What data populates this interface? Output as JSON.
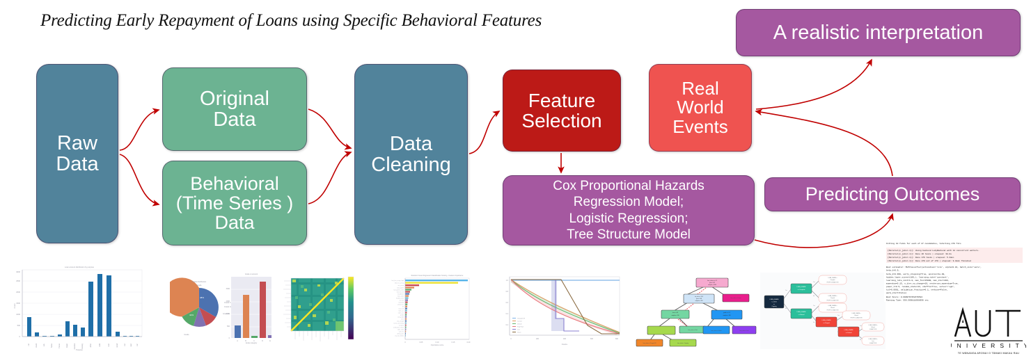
{
  "title": "Predicting Early Repayment of Loans using Specific Behavioral Features",
  "colors": {
    "steel_blue": "#51839b",
    "green": "#6cb392",
    "dark_red": "#bc1a17",
    "purple": "#a558a0",
    "salmon_red": "#ef5350",
    "arrow_red": "#c00000"
  },
  "flow": {
    "raw_data": "Raw\nData",
    "original_data": "Original\nData",
    "behavioral_data": "Behavioral\n(Time Series )\nData",
    "data_cleaning": "Data\nCleaning",
    "feature_selection": "Feature\nSelection",
    "models": "Cox Proportional Hazards\nRegression Model;\nLogistic Regression;\nTree Structure Model",
    "real_world_events": "Real\nWorld\nEvents",
    "realistic_interpretation": "A realistic interpretation",
    "predicting_outcomes": "Predicting Outcomes"
  },
  "thumbnails": [
    {
      "name": "loan-purpose-bar-chart",
      "kind": "bar"
    },
    {
      "name": "grade-pie-and-bar-chart",
      "kind": "pie+bar"
    },
    {
      "name": "feature-correlation-heatmap",
      "kind": "heatmap"
    },
    {
      "name": "feature-importance-bar-chart",
      "kind": "barh"
    },
    {
      "name": "survival-curves-chart",
      "kind": "line"
    },
    {
      "name": "decision-tree-diagram",
      "kind": "tree"
    },
    {
      "name": "model-flow-tree-diagram",
      "kind": "tree"
    },
    {
      "name": "grid-search-log",
      "kind": "code"
    }
  ],
  "code_log": {
    "line1": "Fitting 10 folds for each of 27 candidates, totalling 270 fits",
    "parallel": [
      "[Parallel(n_jobs=-1)]: Using backend LokyBackend with 12 concurrent workers.",
      "[Parallel(n_jobs=-1)]: Done  26 tasks      | elapsed:   38.0s",
      "[Parallel(n_jobs=-1)]: Done 176 tasks      | elapsed:  5.3min",
      "[Parallel(n_jobs=-1)]: Done 270 out of 270 | elapsed:  9.0min finished"
    ],
    "estimator": [
      "Best estimator: MLPClassifier(activation='relu', alpha=0.01, batch_size='auto',",
      "beta_1=0.9,",
      "              beta_2=0.999, early_stopping=True, epsilon=1e-08,",
      "              hidden_layer_sizes=(100,), learning_rate='constant',",
      "              learning_rate_init=1.0, max_fun=15000, max_iter=200,",
      "              momentum=0.15, n_iter_no_change=10, nesterovs_momentum=True,",
      "              power_t=0.5, random_state=43, shuffle=True, solver='sgd',",
      "              tol=0.0001, validation_fraction=0.1, verbose=False,",
      "              warm_start=False)"
    ],
    "score": "Best Score: 0.9999767452379524",
    "runtime": "Running Time: 550.5058118568936 sec"
  },
  "logo": {
    "acronym": "AUT",
    "word": "U N I V E R S I T Y",
    "maori": "TE WĀNANGA ARONUI O TĀMAKI MAKAU RAU"
  }
}
